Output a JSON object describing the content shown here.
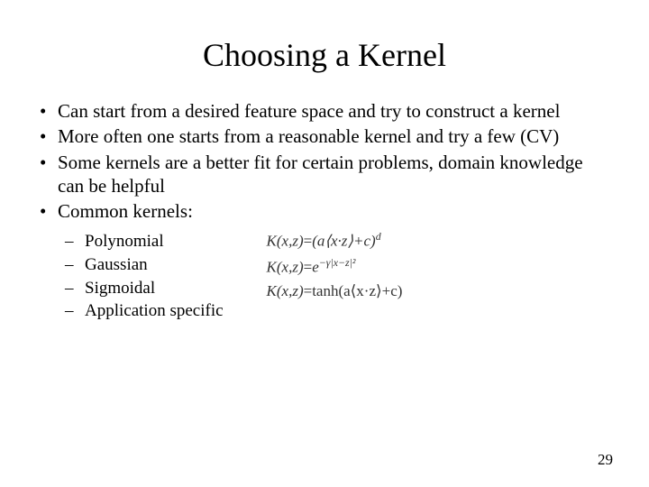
{
  "title": "Choosing a Kernel",
  "bullets": [
    "Can start from a desired feature space and try to construct a kernel",
    "More often one starts from a reasonable kernel and try a few (CV)",
    "Some kernels are a better fit for certain problems, domain knowledge can be helpful",
    "Common kernels:"
  ],
  "subbullets": [
    "Polynomial",
    "Gaussian",
    "Sigmoidal",
    "Application specific"
  ],
  "formulas": {
    "poly_lhs": "K(x,z)",
    "poly_eq": "=",
    "poly_open": "(a⟨x·z⟩+c)",
    "poly_exp": "d",
    "gauss_lhs": "K(x,z)",
    "gauss_eq": "=",
    "gauss_base": "e",
    "gauss_exp": "−γ|x−z|²",
    "sig_lhs": "K(x,z)",
    "sig_eq": "=",
    "sig_rhs": "tanh(a⟨x·z⟩+c)"
  },
  "page_number": "29"
}
